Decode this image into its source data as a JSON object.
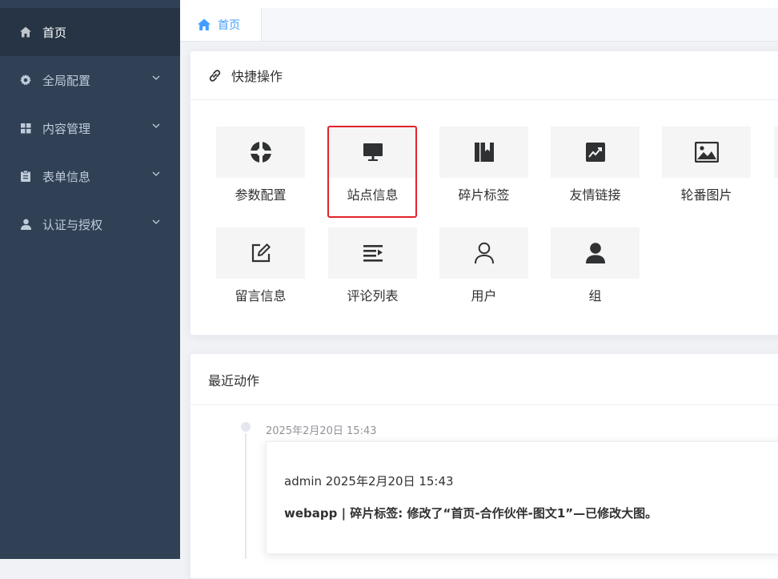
{
  "sidebar": {
    "items": [
      {
        "label": "首页",
        "icon": "home-icon",
        "active": true
      },
      {
        "label": "全局配置",
        "icon": "gear-icon"
      },
      {
        "label": "内容管理",
        "icon": "grid-icon"
      },
      {
        "label": "表单信息",
        "icon": "clipboard-icon"
      },
      {
        "label": "认证与授权",
        "icon": "user-icon"
      }
    ]
  },
  "tabs": [
    {
      "label": "首页",
      "icon": "home-icon"
    }
  ],
  "quick_ops": {
    "title": "快捷操作",
    "items": [
      {
        "label": "参数配置",
        "icon": "lifebuoy-icon"
      },
      {
        "label": "站点信息",
        "icon": "monitor-icon",
        "highlighted": true
      },
      {
        "label": "碎片标签",
        "icon": "book-icon"
      },
      {
        "label": "友情链接",
        "icon": "chart-link-icon"
      },
      {
        "label": "轮番图片",
        "icon": "image-icon"
      },
      {
        "label": "留言信息",
        "icon": "edit-icon"
      },
      {
        "label": "评论列表",
        "icon": "list-icon"
      },
      {
        "label": "用户",
        "icon": "user-outline-icon"
      },
      {
        "label": "组",
        "icon": "user-solid-icon"
      }
    ]
  },
  "recent": {
    "title": "最近动作",
    "entries": [
      {
        "time": "2025年2月20日 15:43",
        "meta": "admin 2025年2月20日 15:43",
        "desc": "webapp | 碎片标签: 修改了“首页-合作伙伴-图文1”—已修改大图。"
      }
    ]
  },
  "colors": {
    "sidebar_bg": "#304156",
    "sidebar_active": "#263445",
    "accent": "#409eff",
    "highlight": "#e1232a"
  }
}
